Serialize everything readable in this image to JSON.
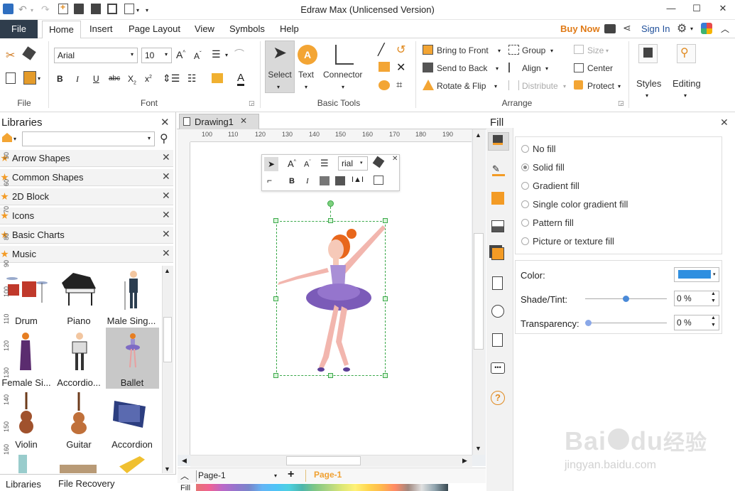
{
  "window": {
    "title": "Edraw Max (Unlicensed Version)",
    "controls": [
      "—",
      "☐",
      "✕"
    ]
  },
  "menu": {
    "file": "File",
    "tabs": [
      "Home",
      "Insert",
      "Page Layout",
      "View",
      "Symbols",
      "Help"
    ],
    "buy_now": "Buy Now",
    "sign_in": "Sign In"
  },
  "ribbon": {
    "file_group": "File",
    "font_group": "Font",
    "font_name": "Arial",
    "font_size": "10",
    "basic_tools_group": "Basic Tools",
    "select": "Select",
    "text": "Text",
    "connector": "Connector",
    "arrange_group": "Arrange",
    "bring_to_front": "Bring to Front",
    "send_to_back": "Send to Back",
    "rotate_flip": "Rotate & Flip",
    "group": "Group",
    "align": "Align",
    "distribute": "Distribute",
    "size": "Size",
    "center": "Center",
    "protect": "Protect",
    "styles": "Styles",
    "editing": "Editing"
  },
  "libraries": {
    "title": "Libraries",
    "rows": [
      "Arrow Shapes",
      "Common Shapes",
      "2D Block",
      "Icons",
      "Basic Charts",
      "Music"
    ],
    "shapes": [
      "Drum",
      "Piano",
      "Male Sing...",
      "Female Si...",
      "Accordio...",
      "Ballet",
      "Violin",
      "Guitar",
      "Accordion"
    ],
    "bottom_tabs": [
      "Libraries",
      "File Recovery"
    ]
  },
  "document": {
    "tab": "Drawing1",
    "ruler_h": [
      "100",
      "110",
      "120",
      "130",
      "140",
      "150",
      "160",
      "170",
      "180",
      "190"
    ],
    "ruler_v": [
      "50",
      "60",
      "70",
      "80",
      "90",
      "100",
      "110",
      "120",
      "130",
      "140",
      "150",
      "160"
    ],
    "float_font": "rial",
    "page_combo": "Page-1",
    "page_tab": "Page-1",
    "fill_label": "Fill"
  },
  "fill_panel": {
    "title": "Fill",
    "options": [
      "No fill",
      "Solid fill",
      "Gradient fill",
      "Single color gradient fill",
      "Pattern fill",
      "Picture or texture fill"
    ],
    "selected_option": "Solid fill",
    "color_label": "Color:",
    "color_value": "#2f8fe0",
    "shade_label": "Shade/Tint:",
    "shade_value": "0 %",
    "transparency_label": "Transparency:",
    "transparency_value": "0 %"
  },
  "colors": {
    "file_tab": "#2f3d4c",
    "buy_now": "#e07a16",
    "accent_orange": "#f39b25",
    "page_tab": "#f0a030"
  },
  "watermark": {
    "text1": "Bai",
    "text2": "du",
    "text3": "经验",
    "url": "jingyan.baidu.com"
  }
}
